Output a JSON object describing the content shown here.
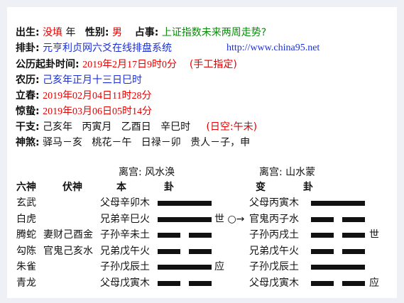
{
  "header": {
    "birth_label": "出生:",
    "birth_value": "没填",
    "year_label": "年",
    "gender_label": "性别:",
    "gender_value": "男",
    "divine_label": "占事:",
    "divine_value": "上证指数未来两周走势?",
    "paigua_label": "排卦:",
    "paigua_value": "元亨利贞网六爻在线排盘系统",
    "paigua_url": "http://www.china95.net",
    "gongli_label": "公历起卦时间:",
    "gongli_value": "2019年2月17日9时0分",
    "gongli_note": "(手工指定)",
    "nongli_label": "农历:",
    "nongli_value": "己亥年正月十三日巳时",
    "lichun_label": "立春:",
    "lichun_value": "2019年02月04日11时28分",
    "jingzhe_label": "惊蛰:",
    "jingzhe_value": "2019年03月06日05时14分",
    "ganzhi_label": "干支:",
    "ganzhi_value": "己亥年   丙寅月   乙酉日   辛巳时",
    "kong_value": "(日空:午未)",
    "shensha_label": "神煞:",
    "shensha_value": "驿马－亥   桃花－午   日禄－卯   贵人－子，申"
  },
  "gua": {
    "ben_title": "离宫:  风水涣",
    "bian_title": "离宫:  山水蒙",
    "col_liushen": "六神",
    "col_fushen": "伏神",
    "col_ben": "本",
    "col_gua": "卦",
    "col_bian": "变",
    "col_gua2": "卦",
    "rows": [
      {
        "liushen": "玄武",
        "fushen": "",
        "ben": "父母辛卯木",
        "mark": "",
        "bian": "父母丙寅木",
        "mark2": ""
      },
      {
        "liushen": "白虎",
        "fushen": "",
        "ben": "兄弟辛巳火",
        "mark": "世 ○→",
        "bian": "官鬼丙子水",
        "mark2": ""
      },
      {
        "liushen": "腾蛇",
        "fushen": "妻财己酉金",
        "ben": "子孙辛未土",
        "mark": "",
        "bian": "子孙丙戌土",
        "mark2": "世"
      },
      {
        "liushen": "勾陈",
        "fushen": "官鬼己亥水",
        "ben": "兄弟戊午火",
        "mark": "",
        "bian": "兄弟戊午火",
        "mark2": ""
      },
      {
        "liushen": "朱雀",
        "fushen": "",
        "ben": "子孙戊辰土",
        "mark": "应",
        "bian": "子孙戊辰土",
        "mark2": ""
      },
      {
        "liushen": "青龙",
        "fushen": "",
        "ben": "父母戊寅木",
        "mark": "",
        "bian": "父母戊寅木",
        "mark2": "应"
      }
    ],
    "ben_lines": [
      "yang",
      "yang",
      "yin",
      "yin",
      "yang",
      "yin"
    ],
    "bian_lines": [
      "yang",
      "yin",
      "yin",
      "yin",
      "yang",
      "yin"
    ]
  }
}
